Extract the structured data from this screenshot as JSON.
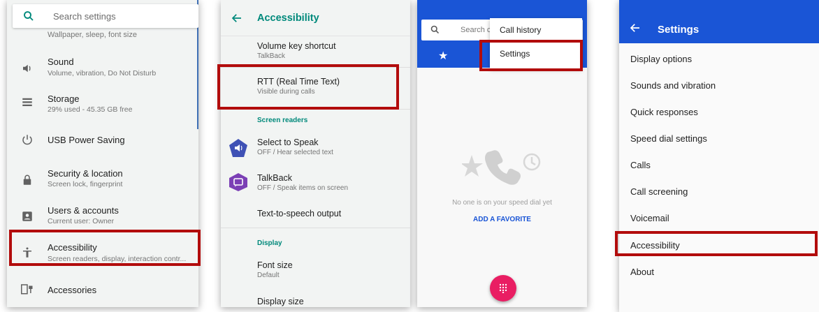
{
  "panel1": {
    "search_placeholder": "Search settings",
    "cut_subtitle": "Wallpaper, sleep, font size",
    "items": [
      {
        "title": "Sound",
        "subtitle": "Volume, vibration, Do Not Disturb",
        "icon": "volume-icon"
      },
      {
        "title": "Storage",
        "subtitle": "29% used - 45.35 GB free",
        "icon": "storage-icon"
      },
      {
        "title": "USB Power Saving",
        "subtitle": "",
        "icon": "power-icon"
      },
      {
        "title": "Security & location",
        "subtitle": "Screen lock, fingerprint",
        "icon": "lock-icon"
      },
      {
        "title": "Users & accounts",
        "subtitle": "Current user: Owner",
        "icon": "account-icon"
      },
      {
        "title": "Accessibility",
        "subtitle": "Screen readers, display, interaction contr...",
        "icon": "accessibility-icon"
      },
      {
        "title": "Accessories",
        "subtitle": "",
        "icon": "accessories-icon"
      }
    ]
  },
  "panel2": {
    "title": "Accessibility",
    "volume_key": {
      "title": "Volume key shortcut",
      "subtitle": "TalkBack"
    },
    "rtt": {
      "title": "RTT (Real Time Text)",
      "subtitle": "Visible during calls"
    },
    "section_screen_readers": "Screen readers",
    "select_to_speak": {
      "title": "Select to Speak",
      "subtitle": "OFF / Hear selected text"
    },
    "talkback": {
      "title": "TalkBack",
      "subtitle": "OFF / Speak items on screen"
    },
    "tts": {
      "title": "Text-to-speech output"
    },
    "section_display": "Display",
    "font_size": {
      "title": "Font size",
      "subtitle": "Default"
    },
    "display_size": {
      "title": "Display size"
    }
  },
  "panel3": {
    "search_placeholder": "Search con",
    "menu": {
      "call_history": "Call history",
      "settings": "Settings"
    },
    "empty_text": "No one is on your speed dial yet",
    "add_favorite": "ADD A FAVORITE"
  },
  "panel4": {
    "title": "Settings",
    "items": [
      "Display options",
      "Sounds and vibration",
      "Quick responses",
      "Speed dial settings",
      "Calls",
      "Call screening",
      "Voicemail",
      "Accessibility",
      "About"
    ]
  },
  "colors": {
    "teal": "#00897b",
    "dialer_blue": "#1a55d6",
    "highlight_red": "#b20c0c",
    "fab_pink": "#e91e63"
  }
}
